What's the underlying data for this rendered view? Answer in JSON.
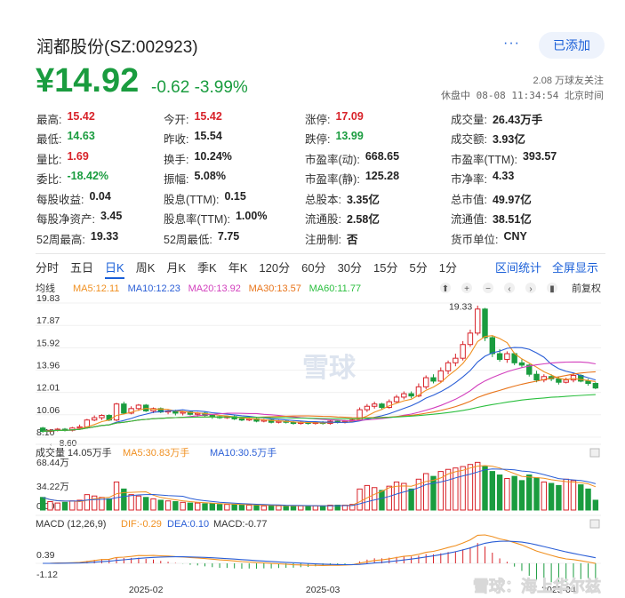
{
  "header": {
    "title": "润都股份(SZ:002923)",
    "more_label": "···",
    "follow_label": "已添加",
    "price": "¥14.92",
    "change": "-0.62 -3.99%",
    "followers": "2.08 万球友关注",
    "status": "休盘中 08-08 11:34:54 北京时间"
  },
  "quote": [
    [
      {
        "l": "最高:",
        "v": "15.42",
        "c": "red"
      },
      {
        "l": "今开:",
        "v": "15.42",
        "c": "red"
      },
      {
        "l": "涨停:",
        "v": "17.09",
        "c": "red"
      },
      {
        "l": "成交量:",
        "v": "26.43万手",
        "c": ""
      }
    ],
    [
      {
        "l": "最低:",
        "v": "14.63",
        "c": "green"
      },
      {
        "l": "昨收:",
        "v": "15.54",
        "c": ""
      },
      {
        "l": "跌停:",
        "v": "13.99",
        "c": "green"
      },
      {
        "l": "成交额:",
        "v": "3.93亿",
        "c": ""
      }
    ],
    [
      {
        "l": "量比:",
        "v": "1.69",
        "c": "red"
      },
      {
        "l": "换手:",
        "v": "10.24%",
        "c": ""
      },
      {
        "l": "市盈率(动):",
        "v": "668.65",
        "c": ""
      },
      {
        "l": "市盈率(TTM):",
        "v": "393.57",
        "c": ""
      }
    ],
    [
      {
        "l": "委比:",
        "v": "-18.42%",
        "c": "green"
      },
      {
        "l": "振幅:",
        "v": "5.08%",
        "c": ""
      },
      {
        "l": "市盈率(静):",
        "v": "125.28",
        "c": ""
      },
      {
        "l": "市净率:",
        "v": "4.33",
        "c": ""
      }
    ],
    [
      {
        "l": "每股收益:",
        "v": "0.04",
        "c": ""
      },
      {
        "l": "股息(TTM):",
        "v": "0.15",
        "c": ""
      },
      {
        "l": "总股本:",
        "v": "3.35亿",
        "c": ""
      },
      {
        "l": "总市值:",
        "v": "49.97亿",
        "c": ""
      }
    ],
    [
      {
        "l": "每股净资产:",
        "v": "3.45",
        "c": ""
      },
      {
        "l": "股息率(TTM):",
        "v": "1.00%",
        "c": ""
      },
      {
        "l": "流通股:",
        "v": "2.58亿",
        "c": ""
      },
      {
        "l": "流通值:",
        "v": "38.51亿",
        "c": ""
      }
    ],
    [
      {
        "l": "52周最高:",
        "v": "19.33",
        "c": ""
      },
      {
        "l": "52周最低:",
        "v": "7.75",
        "c": ""
      },
      {
        "l": "注册制:",
        "v": "否",
        "c": ""
      },
      {
        "l": "货币单位:",
        "v": "CNY",
        "c": ""
      }
    ]
  ],
  "tabs": [
    "分时",
    "五日",
    "日K",
    "周K",
    "月K",
    "季K",
    "年K",
    "120分",
    "60分",
    "30分",
    "15分",
    "5分",
    "1分"
  ],
  "active_tab": "日K",
  "tab_actions": [
    "区间统计",
    "全屏显示"
  ],
  "chart_toolbar": {
    "ma_toggle": "均线",
    "adjust": "前复权",
    "icons": [
      "scroll-up-icon",
      "zoom-in-icon",
      "zoom-out-icon",
      "prev-icon",
      "next-icon",
      "pause-icon"
    ]
  },
  "colors": {
    "up": "#d8232a",
    "down": "#1a9c3f",
    "accent": "#1a5fd8",
    "ma5": "#f09021",
    "ma10": "#2a5ed6",
    "ma20": "#d23fbd",
    "ma30": "#e8741a",
    "ma60": "#2bbf3f",
    "dif": "#f09021",
    "dea": "#2a5ed6"
  },
  "chart_data": {
    "type": "candlestick",
    "ma_legend": [
      {
        "name": "MA5",
        "value": "12.11"
      },
      {
        "name": "MA10",
        "value": "12.23"
      },
      {
        "name": "MA20",
        "value": "13.92"
      },
      {
        "name": "MA30",
        "value": "13.57"
      },
      {
        "name": "MA60",
        "value": "11.77"
      }
    ],
    "price_ticks": [
      "19.83",
      "17.87",
      "15.92",
      "13.96",
      "12.01",
      "10.06",
      "8.10"
    ],
    "ylim": [
      8.1,
      19.83
    ],
    "max_label": "19.33",
    "min_label": "8.60",
    "x_ticks": [
      "2025-02",
      "2025-03",
      "2025-04"
    ],
    "candles": [
      [
        8.9,
        8.6,
        9.0,
        8.5
      ],
      [
        8.6,
        8.7,
        8.8,
        8.5
      ],
      [
        8.7,
        8.8,
        8.9,
        8.6
      ],
      [
        8.8,
        8.7,
        8.9,
        8.6
      ],
      [
        8.7,
        8.9,
        9.0,
        8.6
      ],
      [
        8.9,
        9.0,
        9.2,
        8.8
      ],
      [
        9.0,
        9.6,
        9.7,
        8.9
      ],
      [
        9.6,
        9.8,
        10.0,
        9.5
      ],
      [
        9.8,
        10.0,
        10.1,
        9.6
      ],
      [
        10.0,
        9.6,
        10.1,
        9.5
      ],
      [
        9.6,
        11.0,
        11.1,
        9.5
      ],
      [
        11.0,
        10.2,
        11.2,
        10.1
      ],
      [
        10.2,
        10.6,
        10.8,
        10.1
      ],
      [
        10.6,
        10.9,
        11.0,
        10.4
      ],
      [
        10.9,
        10.4,
        11.0,
        10.3
      ],
      [
        10.4,
        10.6,
        10.7,
        10.2
      ],
      [
        10.6,
        10.3,
        10.7,
        10.2
      ],
      [
        10.3,
        10.4,
        10.5,
        10.1
      ],
      [
        10.4,
        10.2,
        10.5,
        10.0
      ],
      [
        10.2,
        10.3,
        10.4,
        10.0
      ],
      [
        10.3,
        10.1,
        10.4,
        10.0
      ],
      [
        10.1,
        10.2,
        10.3,
        9.9
      ],
      [
        10.2,
        10.0,
        10.3,
        9.9
      ],
      [
        10.0,
        9.9,
        10.1,
        9.7
      ],
      [
        9.9,
        9.8,
        10.0,
        9.7
      ],
      [
        9.8,
        9.9,
        10.0,
        9.7
      ],
      [
        9.9,
        9.7,
        10.0,
        9.6
      ],
      [
        9.7,
        9.6,
        9.8,
        9.5
      ],
      [
        9.6,
        9.7,
        9.8,
        9.5
      ],
      [
        9.7,
        9.5,
        9.8,
        9.4
      ],
      [
        9.5,
        9.6,
        9.7,
        9.4
      ],
      [
        9.6,
        9.4,
        9.7,
        9.3
      ],
      [
        9.4,
        9.5,
        9.6,
        9.3
      ],
      [
        9.5,
        9.4,
        9.6,
        9.3
      ],
      [
        9.4,
        9.3,
        9.5,
        9.2
      ],
      [
        9.3,
        9.4,
        9.5,
        9.2
      ],
      [
        9.4,
        9.3,
        9.5,
        9.2
      ],
      [
        9.3,
        9.4,
        9.5,
        9.2
      ],
      [
        9.4,
        9.3,
        9.5,
        9.2
      ],
      [
        9.3,
        9.5,
        9.6,
        9.2
      ],
      [
        9.5,
        9.4,
        9.6,
        9.3
      ],
      [
        9.4,
        9.5,
        9.6,
        9.3
      ],
      [
        9.5,
        9.6,
        9.7,
        9.4
      ],
      [
        9.6,
        10.5,
        10.7,
        9.5
      ],
      [
        10.5,
        10.8,
        11.0,
        10.3
      ],
      [
        10.8,
        11.0,
        11.2,
        10.6
      ],
      [
        11.0,
        10.7,
        11.1,
        10.5
      ],
      [
        10.7,
        11.2,
        11.4,
        10.6
      ],
      [
        11.2,
        11.6,
        11.8,
        11.1
      ],
      [
        11.6,
        11.9,
        12.1,
        11.4
      ],
      [
        11.9,
        11.7,
        12.1,
        11.5
      ],
      [
        11.7,
        12.5,
        12.8,
        11.6
      ],
      [
        12.5,
        13.3,
        13.5,
        12.3
      ],
      [
        13.3,
        13.0,
        13.6,
        12.8
      ],
      [
        13.0,
        13.9,
        14.2,
        12.9
      ],
      [
        13.9,
        14.6,
        14.8,
        13.6
      ],
      [
        14.6,
        15.0,
        15.4,
        14.3
      ],
      [
        15.0,
        16.2,
        16.5,
        14.8
      ],
      [
        16.2,
        17.2,
        17.5,
        16.0
      ],
      [
        17.2,
        19.3,
        19.6,
        17.0
      ],
      [
        19.3,
        16.8,
        19.4,
        16.5
      ],
      [
        16.8,
        15.4,
        17.0,
        15.1
      ],
      [
        15.4,
        14.9,
        15.8,
        14.7
      ],
      [
        14.9,
        15.4,
        15.6,
        14.6
      ],
      [
        15.4,
        14.6,
        15.5,
        14.4
      ],
      [
        14.6,
        14.4,
        14.9,
        14.2
      ],
      [
        14.4,
        13.6,
        14.5,
        13.4
      ],
      [
        13.6,
        13.1,
        13.9,
        12.9
      ],
      [
        13.1,
        13.4,
        13.6,
        12.9
      ],
      [
        13.4,
        13.2,
        13.6,
        13.0
      ],
      [
        13.2,
        12.9,
        13.4,
        12.7
      ],
      [
        12.9,
        13.1,
        13.3,
        12.8
      ],
      [
        13.1,
        13.5,
        13.7,
        12.9
      ],
      [
        13.5,
        13.0,
        13.6,
        12.9
      ],
      [
        13.0,
        12.8,
        13.2,
        12.6
      ],
      [
        12.8,
        12.4,
        12.9,
        12.3
      ]
    ],
    "volume_legend": {
      "vol": "14.05万手",
      "ma5": "30.83万手",
      "ma10": "30.5万手"
    },
    "volume_ticks": [
      "68.44万",
      "34.22万",
      "0.00"
    ],
    "volume_max": 68.44,
    "volumes": [
      18,
      12,
      10,
      11,
      13,
      14,
      22,
      20,
      18,
      16,
      40,
      30,
      22,
      20,
      18,
      16,
      14,
      13,
      12,
      11,
      10,
      10,
      9,
      9,
      8,
      8,
      8,
      7,
      7,
      7,
      6,
      6,
      6,
      6,
      6,
      6,
      6,
      6,
      6,
      7,
      7,
      7,
      8,
      30,
      35,
      32,
      28,
      34,
      40,
      38,
      30,
      44,
      52,
      48,
      55,
      58,
      60,
      62,
      65,
      68,
      62,
      55,
      50,
      45,
      48,
      42,
      50,
      46,
      40,
      38,
      35,
      44,
      42,
      36,
      30,
      14
    ],
    "macd_legend": {
      "name": "MACD (12,26,9)",
      "dif": "-0.29",
      "dea": "0.10",
      "macd": "-0.77"
    },
    "macd_ticks": [
      "0.39",
      "-1.12"
    ]
  },
  "watermark": "雪球",
  "watermark_footer": "雪球：海上华尔兹"
}
